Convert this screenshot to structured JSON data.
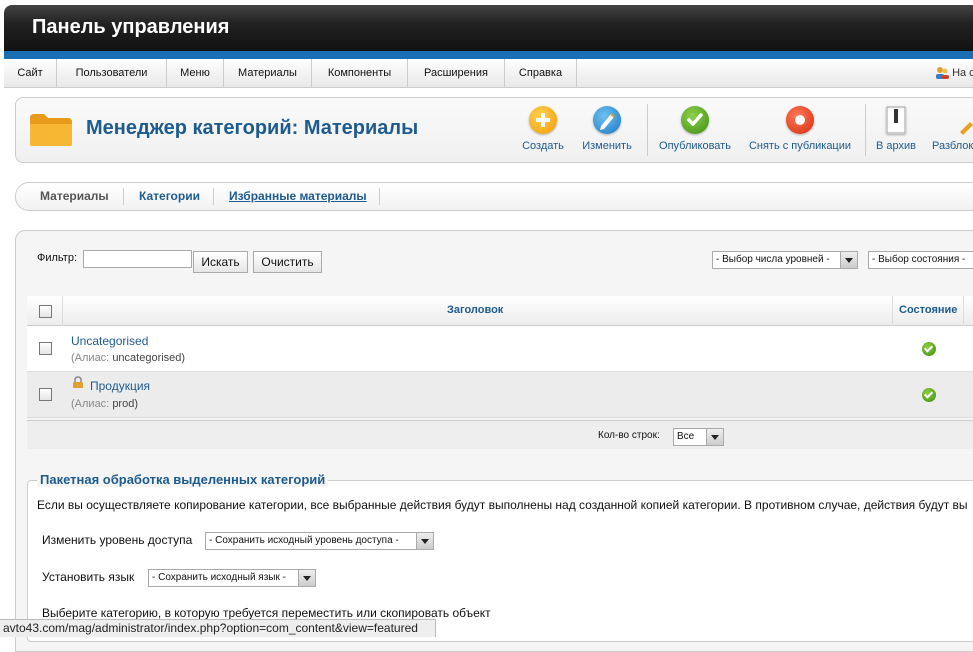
{
  "header": {
    "title": "Панель управления"
  },
  "menu": {
    "items": [
      {
        "label": "Сайт"
      },
      {
        "label": "Пользователи"
      },
      {
        "label": "Меню"
      },
      {
        "label": "Материалы"
      },
      {
        "label": "Компоненты"
      },
      {
        "label": "Расширения"
      },
      {
        "label": "Справка"
      }
    ],
    "user_text": "На с"
  },
  "toolbar": {
    "page_title": "Менеджер категорий: Материалы",
    "buttons": {
      "create": "Создать",
      "edit": "Изменить",
      "publish": "Опубликовать",
      "unpublish": "Снять с публикации",
      "archive": "В архив",
      "checkin": "Разблок"
    }
  },
  "subnav": {
    "items": [
      {
        "label": "Материалы"
      },
      {
        "label": "Категории"
      },
      {
        "label": "Избранные материалы"
      }
    ]
  },
  "filter": {
    "label": "Фильтр:",
    "input_value": "",
    "search_button": "Искать",
    "clear_button": "Очистить",
    "levels_select": "- Выбор числа уровней -",
    "state_select": "- Выбор состояния -"
  },
  "table": {
    "headers": {
      "title": "Заголовок",
      "state": "Состояние"
    },
    "rows": [
      {
        "title": "Uncategorised",
        "alias_label": "(Алиас:",
        "alias_value": "uncategorised)",
        "locked": false,
        "published": true
      },
      {
        "title": "Продукция",
        "alias_label": "(Алиас:",
        "alias_value": "prod)",
        "locked": true,
        "published": true
      }
    ]
  },
  "pagination": {
    "rows_label": "Кол-во строк:",
    "rows_value": "Все"
  },
  "batch": {
    "legend": "Пакетная обработка выделенных категорий",
    "description": "Если вы осуществляете копирование категории, все выбранные действия будут выполнены над созданной копией категории. В противном случае, действия будут вы",
    "access_label": "Изменить уровень доступа",
    "access_select": "- Сохранить исходный уровень доступа -",
    "language_label": "Установить язык",
    "language_select": "- Сохранить исходный язык -",
    "category_label": "Выберите категорию, в которую требуется переместить или скопировать объект"
  },
  "status_bar": {
    "url": "avto43.com/mag/administrator/index.php?option=com_content&view=featured"
  },
  "colors": {
    "accent": "#1e5b8e",
    "topbar": "#1a1a1a",
    "strip": "#1a6fb4"
  }
}
